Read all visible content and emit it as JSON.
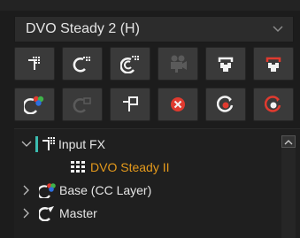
{
  "dropdown": {
    "selected": "DVO Steady 2 (H)",
    "icon": "chevron-down-icon"
  },
  "toolbar_row1": [
    {
      "icon": "add-input-fx-icon",
      "enabled": true
    },
    {
      "icon": "add-curve-layer-icon",
      "enabled": true
    },
    {
      "icon": "add-layer-group-icon",
      "enabled": true
    },
    {
      "icon": "camera-icon",
      "enabled": false
    },
    {
      "icon": "output-node-icon",
      "enabled": true
    },
    {
      "icon": "output-node-red-icon",
      "enabled": true
    }
  ],
  "toolbar_row2": [
    {
      "icon": "cc-layer-icon",
      "enabled": true
    },
    {
      "icon": "curve-disabled-icon",
      "enabled": false
    },
    {
      "icon": "duplicate-icon",
      "enabled": true
    },
    {
      "icon": "delete-icon",
      "enabled": true
    },
    {
      "icon": "record-white-icon",
      "enabled": true
    },
    {
      "icon": "record-red-icon",
      "enabled": true
    }
  ],
  "tree": {
    "input_fx": "Input FX",
    "dvo_steady": "DVO Steady II",
    "base": "Base (CC Layer)",
    "master": "Master"
  },
  "colors": {
    "accent_orange": "#e59a1c",
    "teal": "#3bbcb0",
    "red": "#e03a2f"
  }
}
